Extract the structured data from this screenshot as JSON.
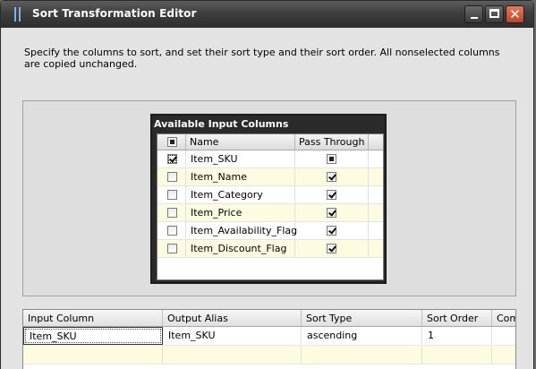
{
  "window": {
    "title": "Sort Transformation Editor"
  },
  "instructions": "Specify the columns to sort, and set their sort type and their sort order. All nonselected columns are copied unchanged.",
  "available": {
    "title": "Available Input Columns",
    "headers": {
      "name": "Name",
      "pass_through": "Pass Through"
    },
    "rows": [
      {
        "name": "Item_SKU",
        "selected": true,
        "pass_through": "indeterminate"
      },
      {
        "name": "Item_Name",
        "selected": false,
        "pass_through": "checked"
      },
      {
        "name": "Item_Category",
        "selected": false,
        "pass_through": "checked"
      },
      {
        "name": "Item_Price",
        "selected": false,
        "pass_through": "checked"
      },
      {
        "name": "Item_Availability_Flag",
        "selected": false,
        "pass_through": "checked"
      },
      {
        "name": "Item_Discount_Flag",
        "selected": false,
        "pass_through": "checked"
      }
    ]
  },
  "sort_grid": {
    "headers": {
      "input_column": "Input Column",
      "output_alias": "Output Alias",
      "sort_type": "Sort Type",
      "sort_order": "Sort Order",
      "comparison_flags": "Com"
    },
    "rows": [
      {
        "input_column": "Item_SKU",
        "output_alias": "Item_SKU",
        "sort_type": "ascending",
        "sort_order": "1"
      }
    ]
  }
}
